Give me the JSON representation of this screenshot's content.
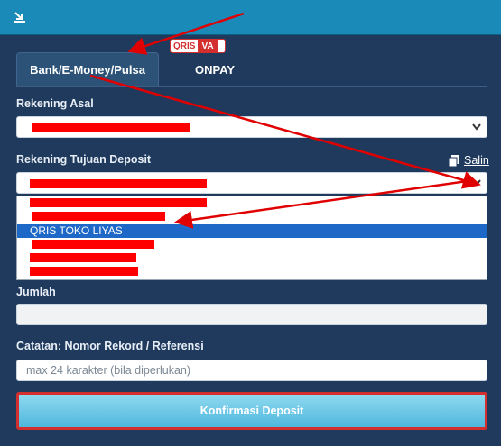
{
  "tabs": {
    "bank": "Bank/E-Money/Pulsa",
    "onpay": "ONPAY",
    "badge_qris": "QRIS",
    "badge_va": "VA"
  },
  "form": {
    "rekening_asal_label": "Rekening Asal",
    "rekening_tujuan_label": "Rekening Tujuan Deposit",
    "salin_label": "Salin",
    "dropdown_selected": "QRIS TOKO LIYAS",
    "jumlah_label": "Jumlah",
    "catatan_label": "Catatan: Nomor Rekord / Referensi",
    "catatan_placeholder": "max 24 karakter (bila diperlukan)",
    "submit_label": "Konfirmasi Deposit"
  },
  "icons": {
    "topbar": "collapse-icon",
    "salin": "copy-icon",
    "select_chevron": "chevron-down-icon"
  },
  "colors": {
    "topbar": "#1a8ab8",
    "panel": "#1f3a5c",
    "selected_option": "#1e69c8",
    "annotation_red": "#e00000",
    "button": "#4fb7dd"
  }
}
